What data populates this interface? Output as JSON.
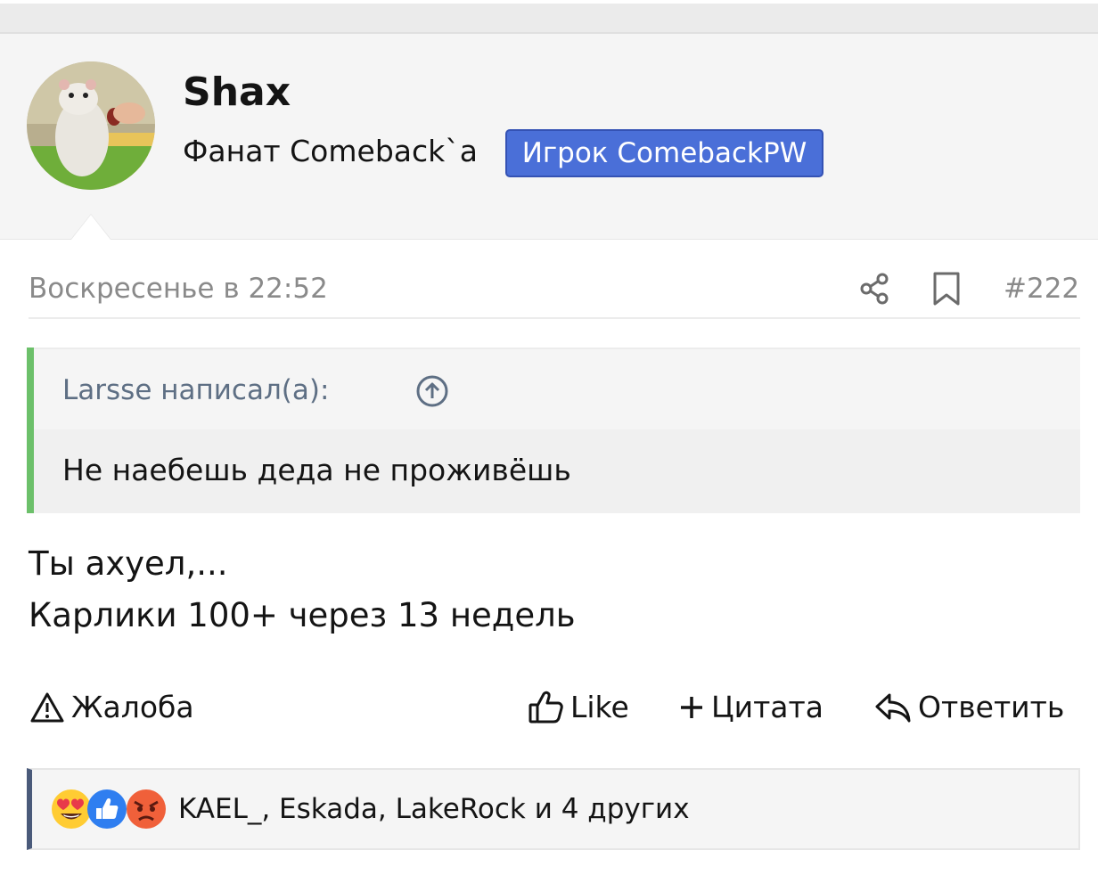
{
  "post": {
    "username": "Shax",
    "user_title": "Фанат Comeback`a",
    "user_badge": "Игрок ComebackPW",
    "date": "Воскресенье в 22:52",
    "post_number": "#222"
  },
  "quote": {
    "author": "Larsse написал(а):",
    "text": "Не наебешь деда не проживёшь"
  },
  "body": {
    "line1": "Ты ахуел,...",
    "line2": "Карлики 100+ через 13 недель"
  },
  "actions": {
    "report": "Жалоба",
    "like": "Like",
    "quote": "Цитата",
    "reply": "Ответить"
  },
  "reactions": {
    "icons": [
      "heart-eyes-emoji-icon",
      "thumbs-up-reaction-icon",
      "angry-face-emoji-icon"
    ],
    "summary": "KAEL_, Eskada, LakeRock и 4 других"
  },
  "colors": {
    "badge": "#4a6fd8",
    "quote_border": "#6cc06a",
    "reactions_border": "#4a5a7a",
    "meta_text": "#8a8a8a"
  }
}
